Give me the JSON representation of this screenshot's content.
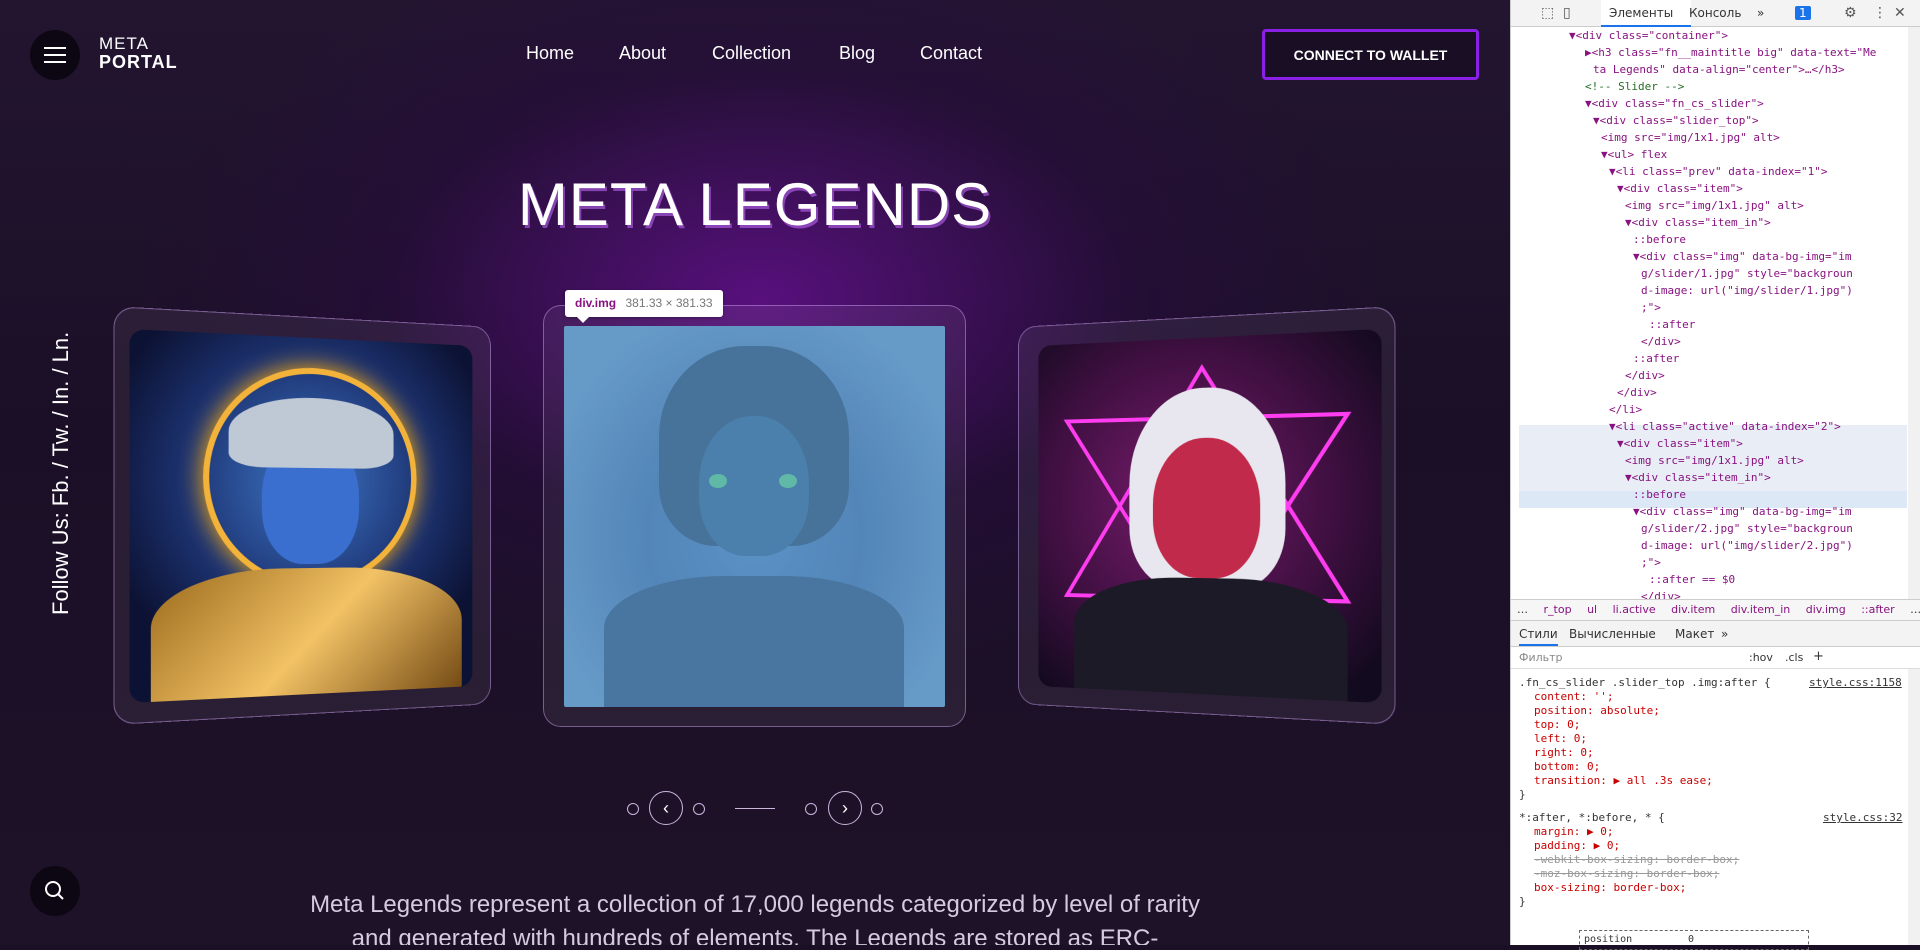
{
  "site": {
    "logo": {
      "line1": "META",
      "line2": "PORTAL"
    },
    "nav": [
      "Home",
      "About",
      "Collection",
      "Blog",
      "Contact"
    ],
    "wallet_button": "CONNECT TO WALLET",
    "follow_text": "Follow Us: Fb. / Tw. / In. / Ln.",
    "title": "META LEGENDS",
    "tooltip": {
      "name": "div.img",
      "size": "381.33 × 381.33"
    },
    "description": "Meta Legends represent a collection of 17,000 legends categorized by level of rarity and generated with hundreds of elements. The Legends are stored as ERC-"
  },
  "devtools": {
    "tabs": [
      "Элементы",
      "Консоль",
      "»"
    ],
    "badge": "1",
    "dom_lines": [
      {
        "indent": 6,
        "text": "▼<div class=\"container\">"
      },
      {
        "indent": 8,
        "text": "▶<h3 class=\"fn__maintitle big\" data-text=\"Me"
      },
      {
        "indent": 9,
        "text": "ta Legends\" data-align=\"center\">…</h3>"
      },
      {
        "indent": 8,
        "text": "<!-- Slider -->"
      },
      {
        "indent": 8,
        "text": "▼<div class=\"fn_cs_slider\">"
      },
      {
        "indent": 9,
        "text": "▼<div class=\"slider_top\">"
      },
      {
        "indent": 10,
        "text": "<img src=\"img/1x1.jpg\" alt>"
      },
      {
        "indent": 10,
        "text": "▼<ul> flex"
      },
      {
        "indent": 11,
        "text": "▼<li class=\"prev\" data-index=\"1\">"
      },
      {
        "indent": 12,
        "text": "▼<div class=\"item\">"
      },
      {
        "indent": 13,
        "text": "<img src=\"img/1x1.jpg\" alt>"
      },
      {
        "indent": 13,
        "text": "▼<div class=\"item_in\">"
      },
      {
        "indent": 14,
        "text": "::before"
      },
      {
        "indent": 14,
        "text": "▼<div class=\"img\" data-bg-img=\"im"
      },
      {
        "indent": 15,
        "text": "g/slider/1.jpg\" style=\"backgroun"
      },
      {
        "indent": 15,
        "text": "d-image: url(\"img/slider/1.jpg\")"
      },
      {
        "indent": 15,
        "text": ";\">"
      },
      {
        "indent": 16,
        "text": "::after"
      },
      {
        "indent": 15,
        "text": "</div>"
      },
      {
        "indent": 14,
        "text": "::after"
      },
      {
        "indent": 13,
        "text": "</div>"
      },
      {
        "indent": 12,
        "text": "</div>"
      },
      {
        "indent": 11,
        "text": "</li>"
      },
      {
        "indent": 11,
        "text": "▼<li class=\"active\" data-index=\"2\">"
      },
      {
        "indent": 12,
        "text": "▼<div class=\"item\">"
      },
      {
        "indent": 13,
        "text": "<img src=\"img/1x1.jpg\" alt>"
      },
      {
        "indent": 13,
        "text": "▼<div class=\"item_in\">"
      },
      {
        "indent": 14,
        "text": "::before"
      },
      {
        "indent": 14,
        "text": "▼<div class=\"img\" data-bg-img=\"im"
      },
      {
        "indent": 15,
        "text": "g/slider/2.jpg\" style=\"backgroun"
      },
      {
        "indent": 15,
        "text": "d-image: url(\"img/slider/2.jpg\")"
      },
      {
        "indent": 15,
        "text": ";\">"
      },
      {
        "indent": 16,
        "text": "::after == $0"
      },
      {
        "indent": 15,
        "text": "</div>"
      }
    ],
    "breadcrumbs": [
      "…",
      "r_top",
      "ul",
      "li.active",
      "div.item",
      "div.item_in",
      "div.img",
      "::after",
      "…"
    ],
    "style_tabs": [
      "Стили",
      "Вычисленные",
      "Макет",
      "»"
    ],
    "filter_placeholder": "Фильтр",
    "filter_tools": [
      ":hov",
      ".cls",
      "+"
    ],
    "rule1": {
      "selector": ".fn_cs_slider .slider_top .img:after {",
      "source": "style.css:1158",
      "props": [
        "content: '';",
        "position: absolute;",
        "top: 0;",
        "left: 0;",
        "right: 0;",
        "bottom: 0;",
        "transition: ▶ all .3s ease;"
      ],
      "close": "}"
    },
    "rule2": {
      "selector": "*:after, *:before, * {",
      "source": "style.css:32",
      "props": [
        "margin: ▶ 0;",
        "padding: ▶ 0;",
        "-webkit-box-sizing: border-box;",
        "-moz-box-sizing: border-box;",
        "box-sizing: border-box;"
      ],
      "close": "}"
    },
    "box_model_label": "position",
    "box_model_value": "0"
  }
}
